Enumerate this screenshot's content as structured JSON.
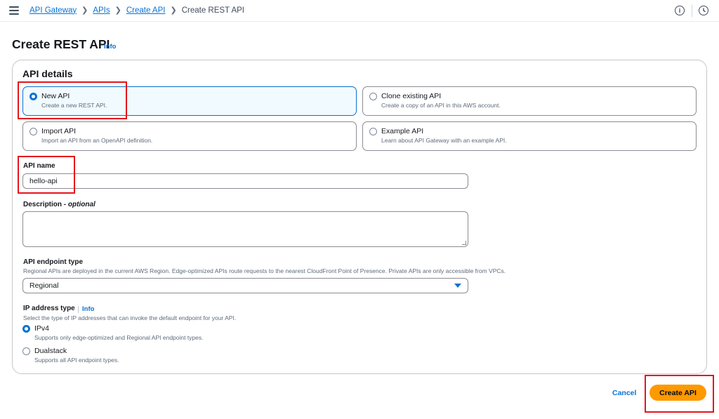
{
  "breadcrumb": {
    "items": [
      "API Gateway",
      "APIs",
      "Create API"
    ],
    "current": "Create REST API"
  },
  "page": {
    "title": "Create REST API",
    "info": "Info"
  },
  "panel": {
    "title": "API details",
    "options": [
      {
        "label": "New API",
        "description": "Create a new REST API.",
        "selected": true
      },
      {
        "label": "Clone existing API",
        "description": "Create a copy of an API in this AWS account.",
        "selected": false
      },
      {
        "label": "Import API",
        "description": "Import an API from an OpenAPI definition.",
        "selected": false
      },
      {
        "label": "Example API",
        "description": "Learn about API Gateway with an example API.",
        "selected": false
      }
    ]
  },
  "api_name": {
    "label": "API name",
    "value": "hello-api"
  },
  "description": {
    "label": "Description - ",
    "label_optional": "optional",
    "value": ""
  },
  "endpoint_type": {
    "label": "API endpoint type",
    "hint": "Regional APIs are deployed in the current AWS Region. Edge-optimized APIs route requests to the nearest CloudFront Point of Presence. Private APIs are only accessible from VPCs.",
    "selected": "Regional"
  },
  "ip_address_type": {
    "label": "IP address type",
    "info": "Info",
    "hint": "Select the type of IP addresses that can invoke the default endpoint for your API.",
    "options": [
      {
        "label": "IPv4",
        "description": "Supports only edge-optimized and Regional API endpoint types.",
        "selected": true
      },
      {
        "label": "Dualstack",
        "description": "Supports all API endpoint types.",
        "selected": false
      }
    ]
  },
  "actions": {
    "cancel": "Cancel",
    "create": "Create API"
  },
  "colors": {
    "accent": "#0972d3",
    "primary_button": "#ff9900",
    "highlight": "#e5141c"
  },
  "icons": {
    "menu": "hamburger-menu-icon",
    "info": "info-circle-icon",
    "notifications": "clock-icon",
    "breadcrumb_separator": "chevron-right-icon",
    "select": "caret-down-icon"
  }
}
